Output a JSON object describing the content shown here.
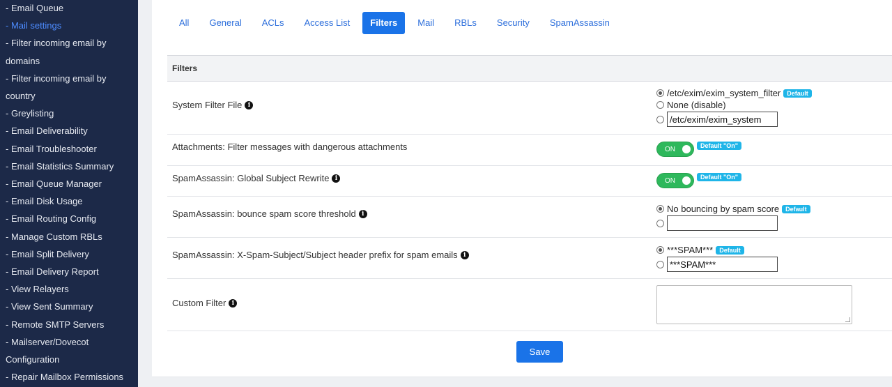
{
  "sidebar": {
    "items": [
      {
        "label": "- Email Queue",
        "cont": ""
      },
      {
        "label": "- Mail settings",
        "cont": "",
        "active": true
      },
      {
        "label": "- Filter incoming email by",
        "cont": "domains"
      },
      {
        "label": "- Filter incoming email by",
        "cont": "country"
      },
      {
        "label": "- Greylisting",
        "cont": ""
      },
      {
        "label": "- Email Deliverability",
        "cont": ""
      },
      {
        "label": "- Email Troubleshooter",
        "cont": ""
      },
      {
        "label": "- Email Statistics Summary",
        "cont": ""
      },
      {
        "label": "- Email Queue Manager",
        "cont": ""
      },
      {
        "label": "- Email Disk Usage",
        "cont": ""
      },
      {
        "label": "- Email Routing Config",
        "cont": ""
      },
      {
        "label": "- Manage Custom RBLs",
        "cont": ""
      },
      {
        "label": "- Email Split Delivery",
        "cont": ""
      },
      {
        "label": "- Email Delivery Report",
        "cont": ""
      },
      {
        "label": "- View Relayers",
        "cont": ""
      },
      {
        "label": "- View Sent Summary",
        "cont": ""
      },
      {
        "label": "- Remote SMTP Servers",
        "cont": ""
      },
      {
        "label": "- Mailserver/Dovecot",
        "cont": "Configuration"
      },
      {
        "label": "- Repair Mailbox Permissions",
        "cont": ""
      }
    ]
  },
  "tabs": [
    {
      "label": "All"
    },
    {
      "label": "General"
    },
    {
      "label": "ACLs"
    },
    {
      "label": "Access List"
    },
    {
      "label": "Filters",
      "active": true
    },
    {
      "label": "Mail"
    },
    {
      "label": "RBLs"
    },
    {
      "label": "Security"
    },
    {
      "label": "SpamAssassin"
    }
  ],
  "section_title": "Filters",
  "info_glyph": "i",
  "rows": {
    "system_filter": {
      "label": "System Filter File",
      "opt1": "/etc/exim/exim_system_filter",
      "opt1_badge": "Default",
      "opt2": "None (disable)",
      "opt3_value": "/etc/exim/exim_system"
    },
    "attachments": {
      "label": "Attachments: Filter messages with dangerous attachments",
      "toggle": "ON",
      "badge": "Default \"On\""
    },
    "subject_rewrite": {
      "label": "SpamAssassin: Global Subject Rewrite",
      "toggle": "ON",
      "badge": "Default \"On\""
    },
    "bounce_threshold": {
      "label": "SpamAssassin: bounce spam score threshold",
      "opt1": "No bouncing by spam score",
      "opt1_badge": "Default",
      "opt2_value": ""
    },
    "spam_prefix": {
      "label": "SpamAssassin: X-Spam-Subject/Subject header prefix for spam emails",
      "opt1": "***SPAM***",
      "opt1_badge": "Default",
      "opt2_value": "***SPAM***"
    },
    "custom_filter": {
      "label": "Custom Filter",
      "value": ""
    }
  },
  "save_label": "Save"
}
